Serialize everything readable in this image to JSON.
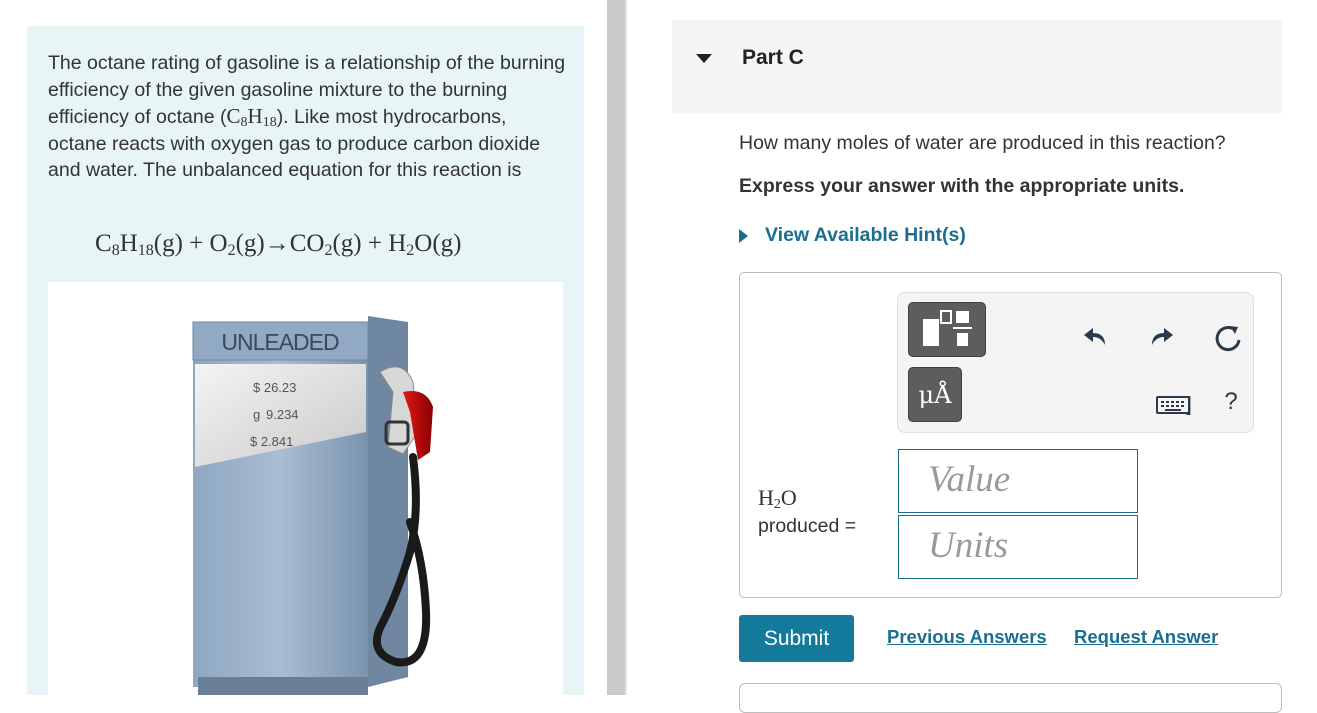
{
  "problem": {
    "intro_part1": "The octane rating of gasoline is a relationship of the burning efficiency of the given gasoline mixture to the burning efficiency of octane (",
    "octane_C": "C",
    "octane_c_sub": "8",
    "octane_H": "H",
    "octane_h_sub": "18",
    "intro_part2": "). Like most hydrocarbons, octane reacts with oxygen gas to produce carbon dioxide and water. The unbalanced equation for this reaction is",
    "equation": {
      "c": "C",
      "c_sub": "8",
      "h": "H",
      "h_sub": "18",
      "g1": "(g) + ",
      "o": "O",
      "o_sub": "2",
      "g2": "(g)→",
      "co": "CO",
      "co_sub": "2",
      "g3": "(g) + ",
      "h2": "H",
      "h2_sub": "2",
      "o2": "O(g)"
    },
    "pump": {
      "brand": "UNLEADED",
      "price_total": "$ 26.23",
      "gallons": "9.234",
      "price_per_gallon": "$ 2.841",
      "gallons_prefix": "g"
    }
  },
  "part": {
    "title": "Part C",
    "question": "How many moles of water are produced in this reaction?",
    "instruction": "Express your answer with the appropriate units.",
    "hint_link": "View Available Hint(s)"
  },
  "toolbar": {
    "units_label": "μÅ",
    "keyboard_bracket": "]",
    "help": "?"
  },
  "answer": {
    "label_H": "H",
    "label_sub": "2",
    "label_O": "O",
    "label_produced": "produced =",
    "value_placeholder": "Value",
    "units_placeholder": "Units"
  },
  "actions": {
    "submit": "Submit",
    "previous_answers": "Previous Answers",
    "request_answer": "Request Answer"
  },
  "colors": {
    "accent": "#147a9c",
    "link": "#1a6e8f",
    "left_panel_bg": "#e8f5f6"
  }
}
